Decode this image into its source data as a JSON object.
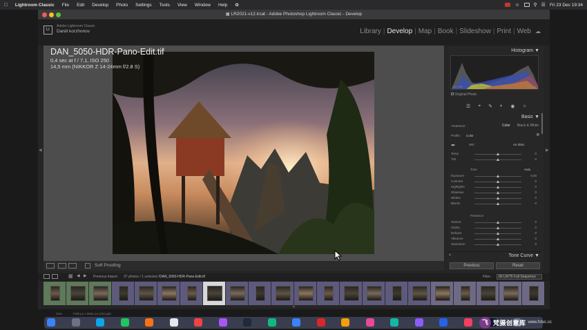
{
  "menubar": {
    "items": [
      "Lightroom Classic",
      "File",
      "Edit",
      "Develop",
      "Photo",
      "Settings",
      "Tools",
      "View",
      "Window",
      "Help"
    ],
    "datetime": "Fri 23 Dec  19:34"
  },
  "window": {
    "title": "LR2021-v12.lrcat - Adobe Photoshop Lightroom Classic - Develop"
  },
  "identity": {
    "line1": "Adobe Lightroom Classic",
    "line2": "Daniil korzhonov"
  },
  "modules": [
    "Library",
    "Develop",
    "Map",
    "Book",
    "Slideshow",
    "Print",
    "Web"
  ],
  "active_module": "Develop",
  "photo_info": {
    "filename": "DAN_5050-HDR-Pano-Edit.tif",
    "exposure": "0,4 sec at f / 7,1, ISO 250",
    "lens": "14,5 mm (NIKKOR Z 14-24mm f/2.8 S)"
  },
  "toolbar": {
    "soft_proofing": "Soft Proofing"
  },
  "histogram": {
    "title": "Histogram",
    "labels": [
      "ISO 250",
      "14,5 mm",
      "f / 7,1",
      "0,4 sec"
    ],
    "original_photo": "Original Photo"
  },
  "basic": {
    "title": "Basic",
    "treatment_label": "Treatment :",
    "color": "Color",
    "bw": "Black & White",
    "profile_label": "Profile :",
    "profile_value": "Color",
    "wb_label": "WB :",
    "wb_value": "As Shot",
    "tone_label": "Tone",
    "auto_label": "Auto",
    "presence_label": "Presence",
    "sliders_wb": [
      {
        "label": "Temp",
        "value": "0"
      },
      {
        "label": "Tint",
        "value": "0"
      }
    ],
    "sliders_tone": [
      {
        "label": "Exposure",
        "value": "0,00"
      },
      {
        "label": "Contrast",
        "value": "0"
      },
      {
        "label": "Highlights",
        "value": "0"
      },
      {
        "label": "Shadows",
        "value": "0"
      },
      {
        "label": "Whites",
        "value": "0"
      },
      {
        "label": "Blacks",
        "value": "0"
      }
    ],
    "sliders_presence": [
      {
        "label": "Texture",
        "value": "0"
      },
      {
        "label": "Clarity",
        "value": "0"
      },
      {
        "label": "Dehaze",
        "value": "0"
      },
      {
        "label": "Vibrance",
        "value": "0"
      },
      {
        "label": "Saturation",
        "value": "0"
      }
    ]
  },
  "tone_curve": {
    "title": "Tone Curve"
  },
  "buttons": {
    "previous": "Previous",
    "reset": "Reset"
  },
  "filmstrip": {
    "source": "Previous Import",
    "count": "37 photos / 1 selected /",
    "selected_file": "DAN_5050-HDR-Pano-Edit.tif",
    "filter_label": "Filter :",
    "filter_value": "00 LR/T5 Full Sequence"
  },
  "status": {
    "zoom": "25%",
    "dims": "7789 px x 8931 px (240 ppi)"
  },
  "watermark": {
    "logo": "飞",
    "name": "梵摄创意库",
    "url": "www.fstvc.cc"
  }
}
